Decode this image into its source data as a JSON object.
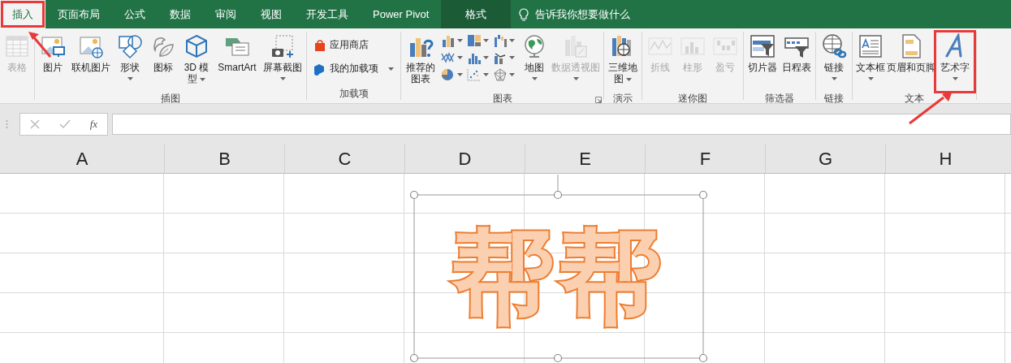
{
  "tabs": [
    {
      "label": "插入",
      "selected": true,
      "highlighted": true,
      "contextual": false
    },
    {
      "label": "页面布局",
      "selected": false,
      "highlighted": false,
      "contextual": false
    },
    {
      "label": "公式",
      "selected": false,
      "highlighted": false,
      "contextual": false
    },
    {
      "label": "数据",
      "selected": false,
      "highlighted": false,
      "contextual": false
    },
    {
      "label": "审阅",
      "selected": false,
      "highlighted": false,
      "contextual": false
    },
    {
      "label": "视图",
      "selected": false,
      "highlighted": false,
      "contextual": false
    },
    {
      "label": "开发工具",
      "selected": false,
      "highlighted": false,
      "contextual": false
    },
    {
      "label": "Power Pivot",
      "selected": false,
      "highlighted": false,
      "contextual": false
    },
    {
      "label": "格式",
      "selected": false,
      "highlighted": false,
      "contextual": true
    }
  ],
  "tell_me": {
    "placeholder": "告诉我你想要做什么"
  },
  "ribbon_groups": [
    {
      "launcher": false,
      "items": [
        {
          "kind": "large",
          "label": "表格",
          "dropdown": false,
          "disabled": true,
          "highlighted": false
        }
      ]
    },
    {
      "label": "插图",
      "launcher": false,
      "items": [
        {
          "kind": "large",
          "label": "图片",
          "dropdown": false,
          "disabled": false,
          "highlighted": false
        },
        {
          "kind": "large",
          "label": "联机图片",
          "dropdown": false,
          "disabled": false,
          "highlighted": false
        },
        {
          "kind": "large",
          "label": "形状",
          "dropdown": true,
          "disabled": false,
          "highlighted": false
        },
        {
          "kind": "large",
          "label": "图标",
          "dropdown": false,
          "disabled": false,
          "highlighted": false
        },
        {
          "kind": "large",
          "label": "3D 模型",
          "dropdown": true,
          "disabled": false,
          "highlighted": false
        },
        {
          "kind": "large",
          "label": "SmartArt",
          "dropdown": false,
          "disabled": false,
          "highlighted": false
        },
        {
          "kind": "large",
          "label": "屏幕截图",
          "dropdown": true,
          "disabled": false,
          "highlighted": false
        }
      ]
    },
    {
      "label": "加载项",
      "launcher": false,
      "items": [
        {
          "kind": "stack",
          "rows": [
            {
              "label": "应用商店",
              "dropdown": false
            },
            {
              "label": "我的加载项",
              "dropdown": true
            }
          ]
        }
      ]
    },
    {
      "label": "图表",
      "launcher": true,
      "items": [
        {
          "kind": "large",
          "label": "推荐的图表",
          "dropdown": false,
          "disabled": false,
          "highlighted": false
        },
        {
          "kind": "grid",
          "cells": [
            {
              "dropdown": true
            },
            {
              "dropdown": true
            },
            {
              "dropdown": true
            },
            {
              "dropdown": true
            },
            {
              "dropdown": true
            },
            {
              "dropdown": true
            },
            {
              "dropdown": true
            },
            {
              "dropdown": true
            },
            {
              "dropdown": true
            }
          ]
        },
        {
          "kind": "large",
          "label": "地图",
          "dropdown": true,
          "disabled": false,
          "highlighted": false
        },
        {
          "kind": "large",
          "label": "数据透视图",
          "dropdown": true,
          "disabled": true,
          "highlighted": false
        }
      ]
    },
    {
      "label": "演示",
      "launcher": false,
      "items": [
        {
          "kind": "large",
          "label": "三维地图",
          "dropdown": true,
          "disabled": false,
          "highlighted": false
        }
      ]
    },
    {
      "label": "迷你图",
      "launcher": false,
      "items": [
        {
          "kind": "large",
          "label": "折线",
          "dropdown": false,
          "disabled": true,
          "highlighted": false
        },
        {
          "kind": "large",
          "label": "柱形",
          "dropdown": false,
          "disabled": true,
          "highlighted": false
        },
        {
          "kind": "large",
          "label": "盈亏",
          "dropdown": false,
          "disabled": true,
          "highlighted": false
        }
      ]
    },
    {
      "label": "筛选器",
      "launcher": false,
      "items": [
        {
          "kind": "large",
          "label": "切片器",
          "dropdown": false,
          "disabled": false,
          "highlighted": false
        },
        {
          "kind": "large",
          "label": "日程表",
          "dropdown": false,
          "disabled": false,
          "highlighted": false
        }
      ]
    },
    {
      "label": "链接",
      "launcher": false,
      "items": [
        {
          "kind": "large",
          "label": "链接",
          "dropdown": true,
          "disabled": false,
          "highlighted": false
        }
      ]
    },
    {
      "label": "文本",
      "launcher": false,
      "items": [
        {
          "kind": "large",
          "label": "文本框",
          "dropdown": true,
          "disabled": false,
          "highlighted": false
        },
        {
          "kind": "large",
          "label": "页眉和页脚",
          "dropdown": false,
          "disabled": false,
          "highlighted": false
        },
        {
          "kind": "large",
          "label": "艺术字",
          "dropdown": true,
          "disabled": false,
          "highlighted": true
        }
      ]
    }
  ],
  "formula_bar": {
    "function_label": "fx"
  },
  "columns": [
    "A",
    "B",
    "C",
    "D",
    "E",
    "F",
    "G",
    "H"
  ],
  "wordart": {
    "text": "帮帮",
    "selected": true
  }
}
